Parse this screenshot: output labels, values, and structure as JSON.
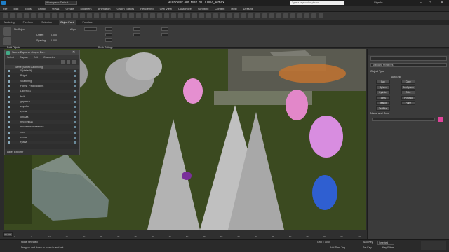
{
  "title_bar": {
    "workspace": "Workspace: Default",
    "title": "Autodesk 3ds Max 2017   002_4.max",
    "search_placeholder": "Type a keyword or phrase",
    "signin": "Sign In"
  },
  "menu": [
    "File",
    "Edit",
    "Tools",
    "Group",
    "Views",
    "Create",
    "Modifiers",
    "Animation",
    "Graph Editors",
    "Rendering",
    "Civil View",
    "Customize",
    "Scripting",
    "Content",
    "Help",
    "Dessine"
  ],
  "ribbon_tabs": [
    "Modeling",
    "Freeform",
    "Selection",
    "Object Paint",
    "Populate"
  ],
  "ribbon": {
    "left_label": "No Object",
    "align": "Align",
    "spacing_label": "Spacing:",
    "spacing_value": "0.000",
    "offset_label": "Offset:",
    "offset_value": "0.000",
    "paint_objects": "Paint Objects",
    "brush_settings": "Brush Settings"
  },
  "scene_explorer": {
    "title": "Scene Explorer - Layer Ex...",
    "menu": [
      "Select",
      "Display",
      "Edit",
      "Customize"
    ],
    "column": "Name (Sorted Ascending)",
    "rows": [
      "0 (default)",
      "Bright",
      "Scattering",
      "Forest_Pack(hidden)",
      "Layer001",
      "fruit",
      "деревья",
      "клумбы",
      "кусты",
      "ограда",
      "песочница",
      "постельная лавочка",
      "пол",
      "стены",
      "трава"
    ],
    "footer": "Layer Explorer"
  },
  "command_panel": {
    "dropdown": "Standard Primitives",
    "section_object_type": "Object Type",
    "autogrid": "AutoGrid",
    "buttons": [
      "Box",
      "Cone",
      "Sphere",
      "GeoSphere",
      "Cylinder",
      "Tube",
      "Torus",
      "Pyramid",
      "Teapot",
      "Plane",
      "TextPlus"
    ],
    "section_name_color": "Name and Color"
  },
  "timeline": {
    "frame": "0 / 100",
    "ticks": [
      "0",
      "5",
      "10",
      "15",
      "20",
      "25",
      "30",
      "35",
      "40",
      "45",
      "50",
      "55",
      "60",
      "65",
      "70",
      "75",
      "80",
      "85",
      "90",
      "95",
      "100"
    ]
  },
  "status": {
    "selection": "None Selected",
    "hint": "Drag up-and-down to zoom in and out",
    "grid": "Grid = 10,0",
    "autokey": "Auto Key",
    "selected": "Selected",
    "setkey": "Set Key",
    "key_filters": "Key Filters...",
    "add_time_tag": "Add Time Tag"
  },
  "colors": {
    "panel_bg": "#3a3a3a",
    "title_bg": "#1f1f1f",
    "viewport_grass": "#3b4a20",
    "accent_pink": "#e0439b",
    "selection_blue": "#2f5fd1"
  }
}
